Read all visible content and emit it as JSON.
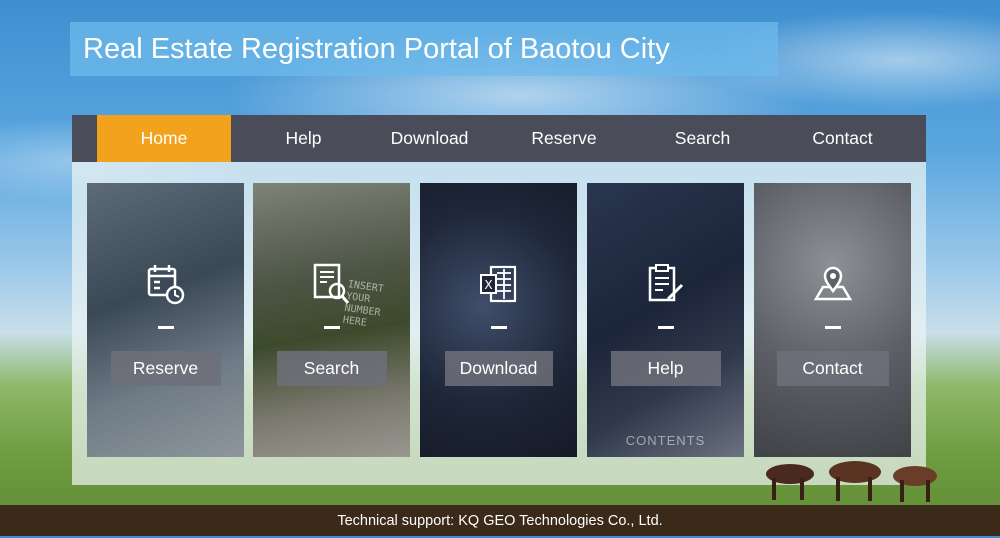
{
  "page": {
    "title": "Real Estate Registration Portal of Baotou City"
  },
  "nav": {
    "items": [
      {
        "label": "Home",
        "active": true
      },
      {
        "label": "Help",
        "active": false
      },
      {
        "label": "Download",
        "active": false
      },
      {
        "label": "Reserve",
        "active": false
      },
      {
        "label": "Search",
        "active": false
      },
      {
        "label": "Contact",
        "active": false
      }
    ]
  },
  "cards": [
    {
      "label": "Reserve",
      "icon": "calendar-clock-icon"
    },
    {
      "label": "Search",
      "icon": "document-search-icon"
    },
    {
      "label": "Download",
      "icon": "excel-file-icon"
    },
    {
      "label": "Help",
      "icon": "clipboard-pen-icon"
    },
    {
      "label": "Contact",
      "icon": "map-pin-icon"
    }
  ],
  "card_photo_text": {
    "search_screen": "INSERT YOUR NUMBER HERE",
    "help_screen": "CONTENTS"
  },
  "footer": {
    "text": "Technical support: KQ GEO Technologies Co., Ltd."
  },
  "colors": {
    "nav_bg": "#4a4c5a",
    "nav_active": "#f2a21c",
    "footer_bg": "#3b2a1a"
  }
}
